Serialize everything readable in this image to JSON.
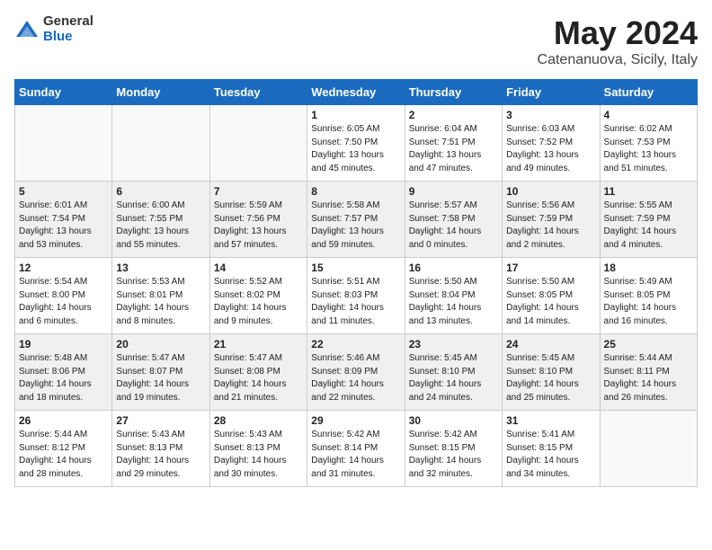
{
  "header": {
    "logo_general": "General",
    "logo_blue": "Blue",
    "title": "May 2024",
    "location": "Catenanuova, Sicily, Italy"
  },
  "weekdays": [
    "Sunday",
    "Monday",
    "Tuesday",
    "Wednesday",
    "Thursday",
    "Friday",
    "Saturday"
  ],
  "weeks": [
    [
      {
        "day": "",
        "info": ""
      },
      {
        "day": "",
        "info": ""
      },
      {
        "day": "",
        "info": ""
      },
      {
        "day": "1",
        "info": "Sunrise: 6:05 AM\nSunset: 7:50 PM\nDaylight: 13 hours\nand 45 minutes."
      },
      {
        "day": "2",
        "info": "Sunrise: 6:04 AM\nSunset: 7:51 PM\nDaylight: 13 hours\nand 47 minutes."
      },
      {
        "day": "3",
        "info": "Sunrise: 6:03 AM\nSunset: 7:52 PM\nDaylight: 13 hours\nand 49 minutes."
      },
      {
        "day": "4",
        "info": "Sunrise: 6:02 AM\nSunset: 7:53 PM\nDaylight: 13 hours\nand 51 minutes."
      }
    ],
    [
      {
        "day": "5",
        "info": "Sunrise: 6:01 AM\nSunset: 7:54 PM\nDaylight: 13 hours\nand 53 minutes."
      },
      {
        "day": "6",
        "info": "Sunrise: 6:00 AM\nSunset: 7:55 PM\nDaylight: 13 hours\nand 55 minutes."
      },
      {
        "day": "7",
        "info": "Sunrise: 5:59 AM\nSunset: 7:56 PM\nDaylight: 13 hours\nand 57 minutes."
      },
      {
        "day": "8",
        "info": "Sunrise: 5:58 AM\nSunset: 7:57 PM\nDaylight: 13 hours\nand 59 minutes."
      },
      {
        "day": "9",
        "info": "Sunrise: 5:57 AM\nSunset: 7:58 PM\nDaylight: 14 hours\nand 0 minutes."
      },
      {
        "day": "10",
        "info": "Sunrise: 5:56 AM\nSunset: 7:59 PM\nDaylight: 14 hours\nand 2 minutes."
      },
      {
        "day": "11",
        "info": "Sunrise: 5:55 AM\nSunset: 7:59 PM\nDaylight: 14 hours\nand 4 minutes."
      }
    ],
    [
      {
        "day": "12",
        "info": "Sunrise: 5:54 AM\nSunset: 8:00 PM\nDaylight: 14 hours\nand 6 minutes."
      },
      {
        "day": "13",
        "info": "Sunrise: 5:53 AM\nSunset: 8:01 PM\nDaylight: 14 hours\nand 8 minutes."
      },
      {
        "day": "14",
        "info": "Sunrise: 5:52 AM\nSunset: 8:02 PM\nDaylight: 14 hours\nand 9 minutes."
      },
      {
        "day": "15",
        "info": "Sunrise: 5:51 AM\nSunset: 8:03 PM\nDaylight: 14 hours\nand 11 minutes."
      },
      {
        "day": "16",
        "info": "Sunrise: 5:50 AM\nSunset: 8:04 PM\nDaylight: 14 hours\nand 13 minutes."
      },
      {
        "day": "17",
        "info": "Sunrise: 5:50 AM\nSunset: 8:05 PM\nDaylight: 14 hours\nand 14 minutes."
      },
      {
        "day": "18",
        "info": "Sunrise: 5:49 AM\nSunset: 8:05 PM\nDaylight: 14 hours\nand 16 minutes."
      }
    ],
    [
      {
        "day": "19",
        "info": "Sunrise: 5:48 AM\nSunset: 8:06 PM\nDaylight: 14 hours\nand 18 minutes."
      },
      {
        "day": "20",
        "info": "Sunrise: 5:47 AM\nSunset: 8:07 PM\nDaylight: 14 hours\nand 19 minutes."
      },
      {
        "day": "21",
        "info": "Sunrise: 5:47 AM\nSunset: 8:08 PM\nDaylight: 14 hours\nand 21 minutes."
      },
      {
        "day": "22",
        "info": "Sunrise: 5:46 AM\nSunset: 8:09 PM\nDaylight: 14 hours\nand 22 minutes."
      },
      {
        "day": "23",
        "info": "Sunrise: 5:45 AM\nSunset: 8:10 PM\nDaylight: 14 hours\nand 24 minutes."
      },
      {
        "day": "24",
        "info": "Sunrise: 5:45 AM\nSunset: 8:10 PM\nDaylight: 14 hours\nand 25 minutes."
      },
      {
        "day": "25",
        "info": "Sunrise: 5:44 AM\nSunset: 8:11 PM\nDaylight: 14 hours\nand 26 minutes."
      }
    ],
    [
      {
        "day": "26",
        "info": "Sunrise: 5:44 AM\nSunset: 8:12 PM\nDaylight: 14 hours\nand 28 minutes."
      },
      {
        "day": "27",
        "info": "Sunrise: 5:43 AM\nSunset: 8:13 PM\nDaylight: 14 hours\nand 29 minutes."
      },
      {
        "day": "28",
        "info": "Sunrise: 5:43 AM\nSunset: 8:13 PM\nDaylight: 14 hours\nand 30 minutes."
      },
      {
        "day": "29",
        "info": "Sunrise: 5:42 AM\nSunset: 8:14 PM\nDaylight: 14 hours\nand 31 minutes."
      },
      {
        "day": "30",
        "info": "Sunrise: 5:42 AM\nSunset: 8:15 PM\nDaylight: 14 hours\nand 32 minutes."
      },
      {
        "day": "31",
        "info": "Sunrise: 5:41 AM\nSunset: 8:15 PM\nDaylight: 14 hours\nand 34 minutes."
      },
      {
        "day": "",
        "info": ""
      }
    ]
  ]
}
